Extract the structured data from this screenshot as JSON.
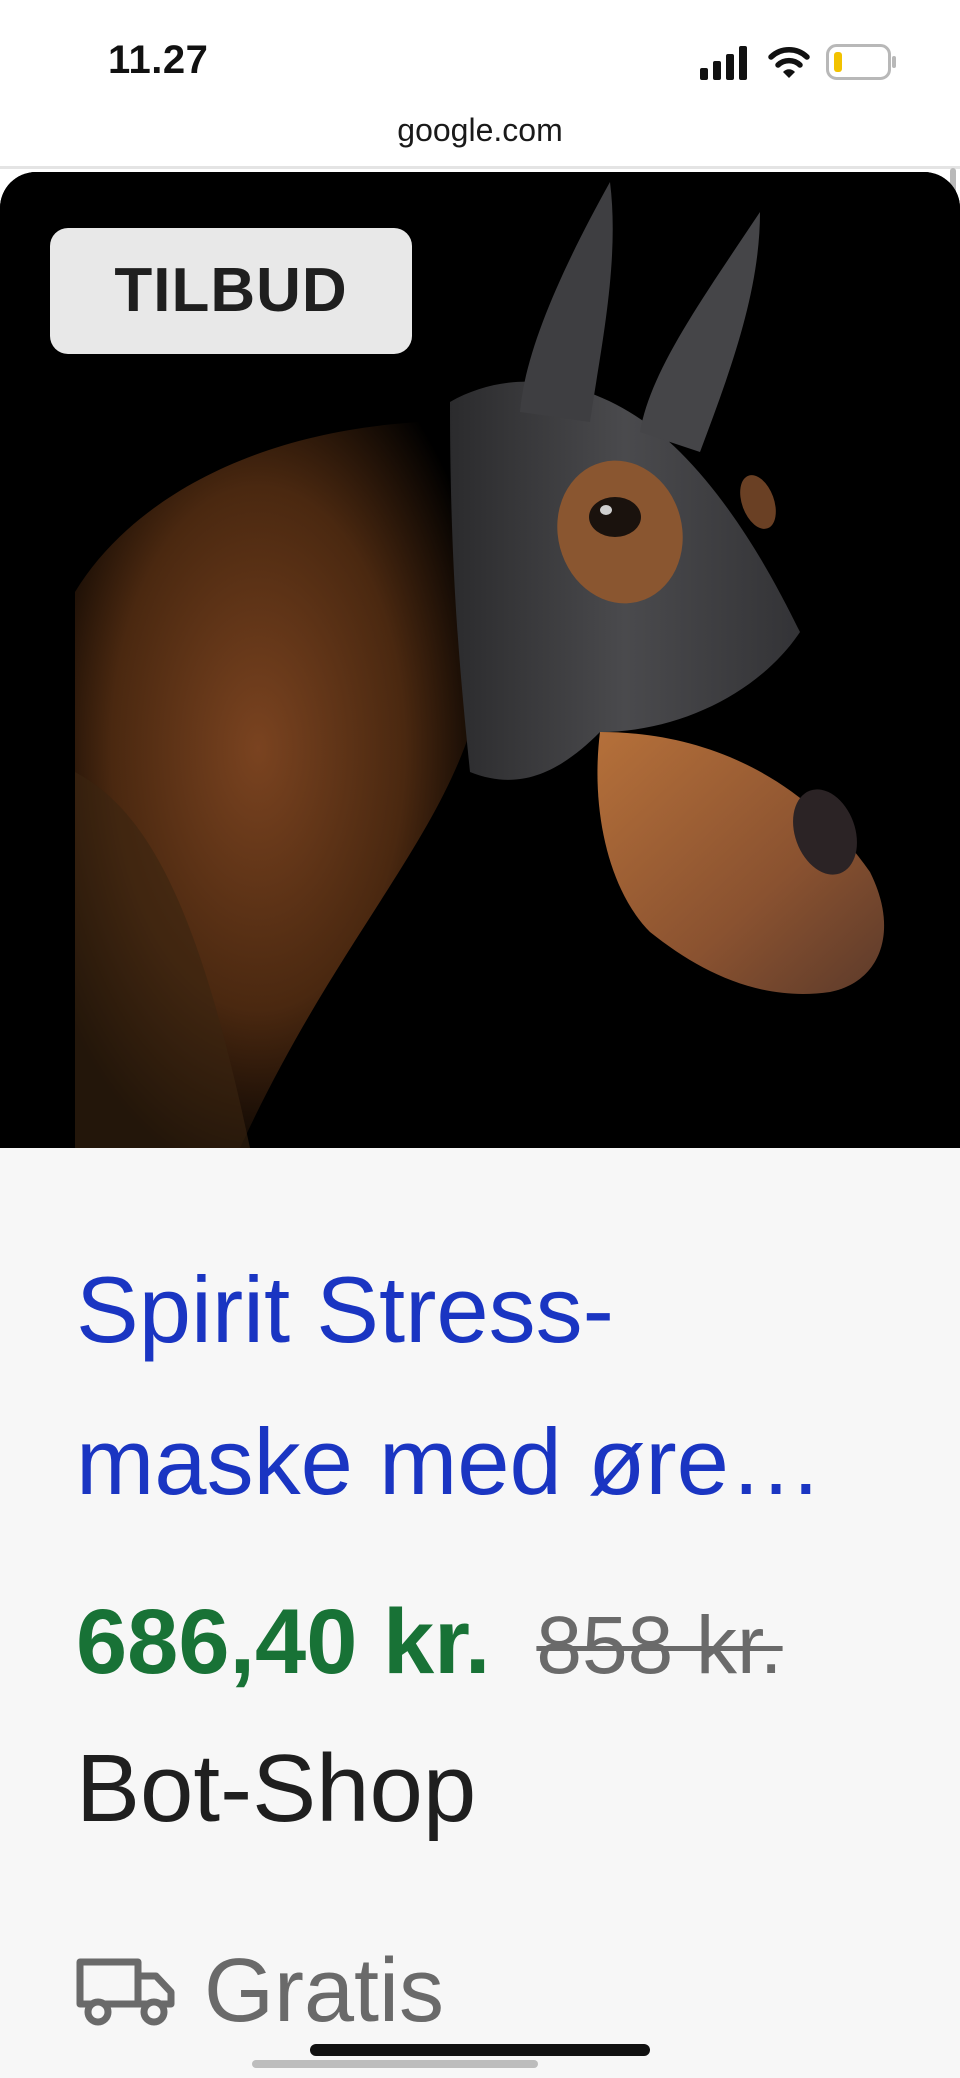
{
  "status_bar": {
    "time": "11.27",
    "icons": [
      "signal-icon",
      "wifi-icon",
      "battery-icon"
    ],
    "battery_color": "#f2c200"
  },
  "browser": {
    "url": "google.com"
  },
  "product": {
    "badge": "TILBUD",
    "image_subject": "horse-with-grey-ear-mask",
    "title_line_1": "Spirit Stress-",
    "title_line_2": "maske med øre…",
    "price_sale": "686,40 kr.",
    "price_original": "858 kr.",
    "seller": "Bot-Shop",
    "shipping": "Gratis",
    "colors": {
      "title": "#1a35c2",
      "sale_price": "#187236",
      "original_price": "#6a6a6a"
    }
  }
}
